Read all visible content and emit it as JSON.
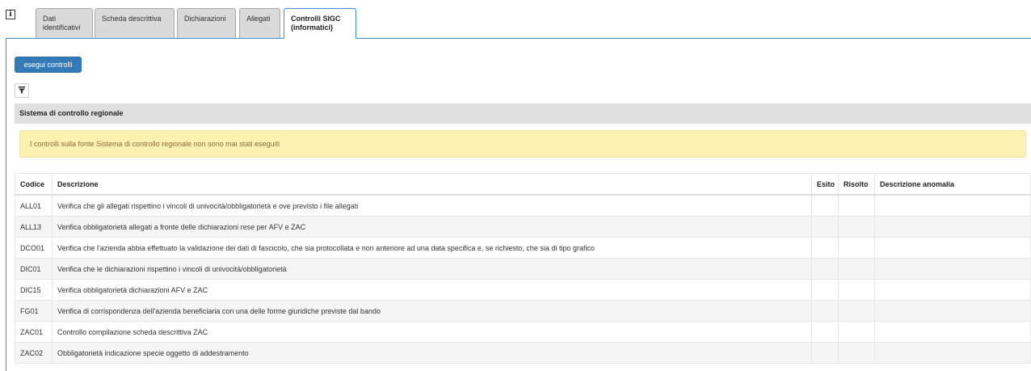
{
  "tabs": [
    {
      "label_line1": "Dati",
      "label_line2": "identificativi",
      "active": false
    },
    {
      "label_line1": "Scheda descrittiva",
      "label_line2": "",
      "active": false
    },
    {
      "label_line1": "Dichiarazioni",
      "label_line2": "",
      "active": false
    },
    {
      "label_line1": "Allegati",
      "label_line2": "",
      "active": false
    },
    {
      "label_line1": "Controlli SIGC",
      "label_line2": "(informatici)",
      "active": true
    }
  ],
  "info_icon": "i",
  "buttons": {
    "run_checks": "esegui controlli",
    "filter_icon": "filter-icon"
  },
  "section": {
    "title": "Sistema di controllo regionale",
    "alert": "I controlli sulla fonte Sistema di controllo regionale non sono mai stati eseguiti"
  },
  "table": {
    "headers": [
      "Codice",
      "Descrizione",
      "Esito",
      "Risolto",
      "Descrizione anomalia"
    ],
    "rows": [
      {
        "code": "ALL01",
        "desc": "Verifica che gli allegati rispettino i vincoli di univocità/obbligatorietà e ove previsto i file allegati"
      },
      {
        "code": "ALL13",
        "desc": "Verifica obbligatorietà allegati a fronte delle dichiarazioni rese per AFV e ZAC"
      },
      {
        "code": "DCO01",
        "desc": "Verifica che l'azienda abbia effettuato la validazione dei dati di fascicolo, che sia protocollata e non anteriore ad una data specifica e, se richiesto, che sia di tipo grafico"
      },
      {
        "code": "DIC01",
        "desc": "Verifica che le dichiarazioni rispettino i vincoli di univocità/obbligatorietà"
      },
      {
        "code": "DIC15",
        "desc": "Verifica obbligatorietà dichiarazioni AFV e ZAC"
      },
      {
        "code": "FG01",
        "desc": "Verifica di corrispondenza dell'azienda beneficiaria con una delle forme giuridiche previste dal bando"
      },
      {
        "code": "ZAC01",
        "desc": "Controllo compilazione scheda descrittiva ZAC"
      },
      {
        "code": "ZAC02",
        "desc": "Obbligatorietà indicazione specie oggetto di addestramento"
      }
    ]
  }
}
